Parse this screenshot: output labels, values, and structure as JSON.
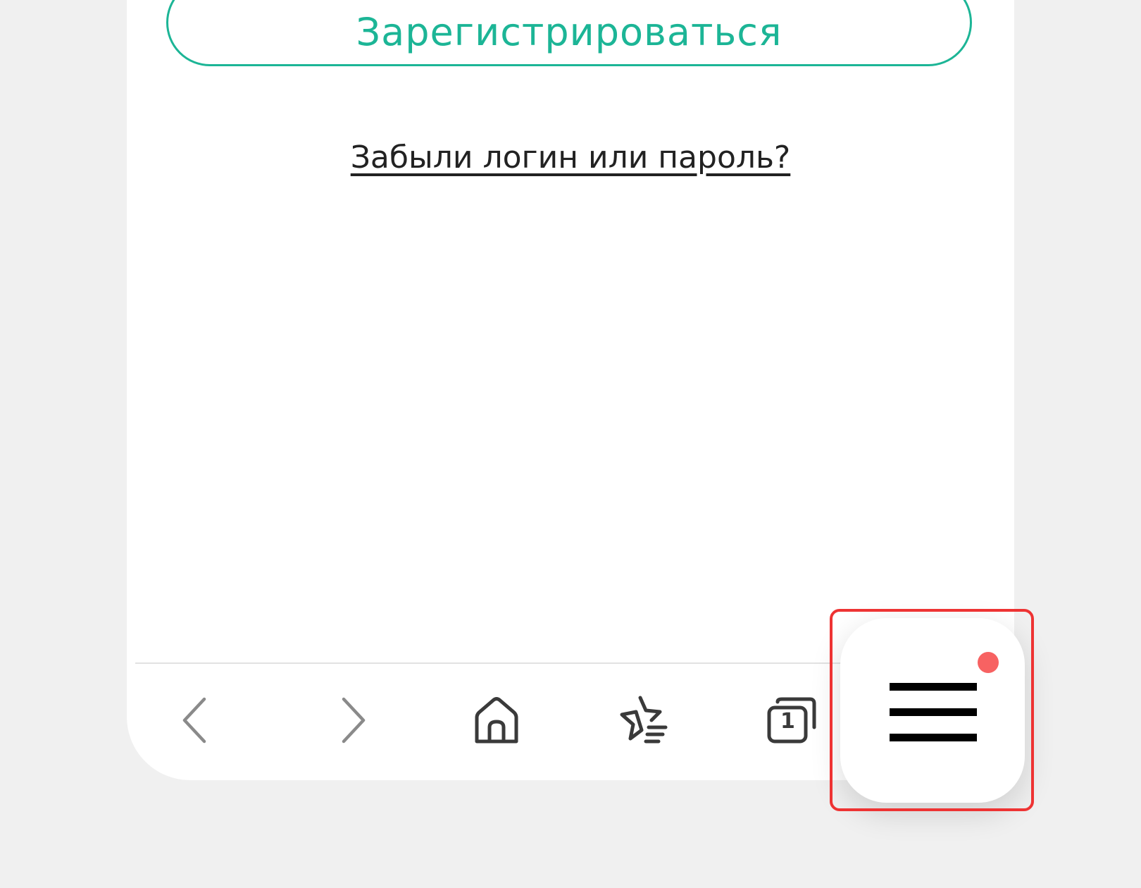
{
  "page": {
    "register_label": "Зарегистрироваться",
    "forgot_link": "Забыли логин или пароль?"
  },
  "toolbar": {
    "tabs_count": "1",
    "items": [
      {
        "name": "back",
        "icon": "chevron-left-icon"
      },
      {
        "name": "forward",
        "icon": "chevron-right-icon"
      },
      {
        "name": "home",
        "icon": "home-icon"
      },
      {
        "name": "bookmarks",
        "icon": "star-list-icon"
      },
      {
        "name": "tabs",
        "icon": "tabs-icon"
      },
      {
        "name": "menu",
        "icon": "hamburger-menu-icon"
      }
    ]
  },
  "colors": {
    "accent": "#1cb596",
    "background": "#f0f0f0",
    "notification_dot": "#f76262",
    "highlight": "#ee3333"
  }
}
